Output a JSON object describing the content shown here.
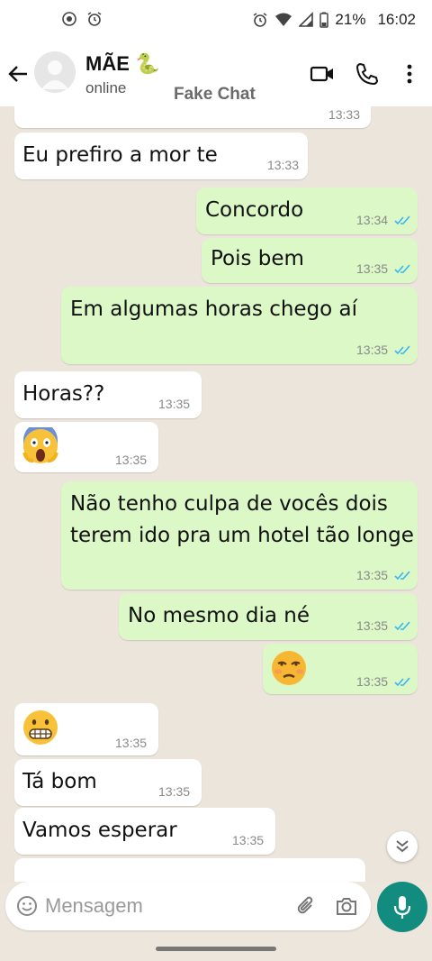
{
  "status_bar": {
    "battery": "21%",
    "time": "16:02",
    "icons": [
      "location-icon",
      "alarm-icon",
      "alarm-icon",
      "wifi-icon",
      "signal-icon",
      "battery-icon"
    ]
  },
  "header": {
    "contact_name": "MÃE 🐍",
    "status": "online",
    "watermark": "Fake Chat"
  },
  "messages": [
    {
      "dir": "in",
      "text": "",
      "time": "13:33"
    },
    {
      "dir": "in",
      "text": "Eu prefiro a mor te",
      "time": "13:33"
    },
    {
      "dir": "out",
      "text": "Concordo",
      "time": "13:34",
      "read": true
    },
    {
      "dir": "out",
      "text": "Pois bem",
      "time": "13:35",
      "read": true
    },
    {
      "dir": "out",
      "text": "Em algumas horas chego aí",
      "time": "13:35",
      "read": true
    },
    {
      "dir": "in",
      "text": "Horas??",
      "time": "13:35"
    },
    {
      "dir": "in",
      "emoji": "face-screaming-in-fear",
      "time": "13:35"
    },
    {
      "dir": "out",
      "text_line1": "Não tenho culpa de vocês dois",
      "text_line2": "terem ido pra um hotel tão longe",
      "time": "13:35",
      "read": true
    },
    {
      "dir": "out",
      "text": "No mesmo dia né",
      "time": "13:35",
      "read": true
    },
    {
      "dir": "out",
      "emoji": "unamused-face",
      "time": "13:35",
      "read": true
    },
    {
      "dir": "in",
      "emoji": "grimacing-face",
      "time": "13:35"
    },
    {
      "dir": "in",
      "text": "Tá bom",
      "time": "13:35"
    },
    {
      "dir": "in",
      "text": "Vamos esperar",
      "time": "13:35"
    }
  ],
  "composer": {
    "placeholder": "Mensagem"
  },
  "colors": {
    "incoming": "#ffffff",
    "outgoing": "#dcf8c6",
    "accent": "#128c7e",
    "read_ticks": "#34b7f1"
  }
}
